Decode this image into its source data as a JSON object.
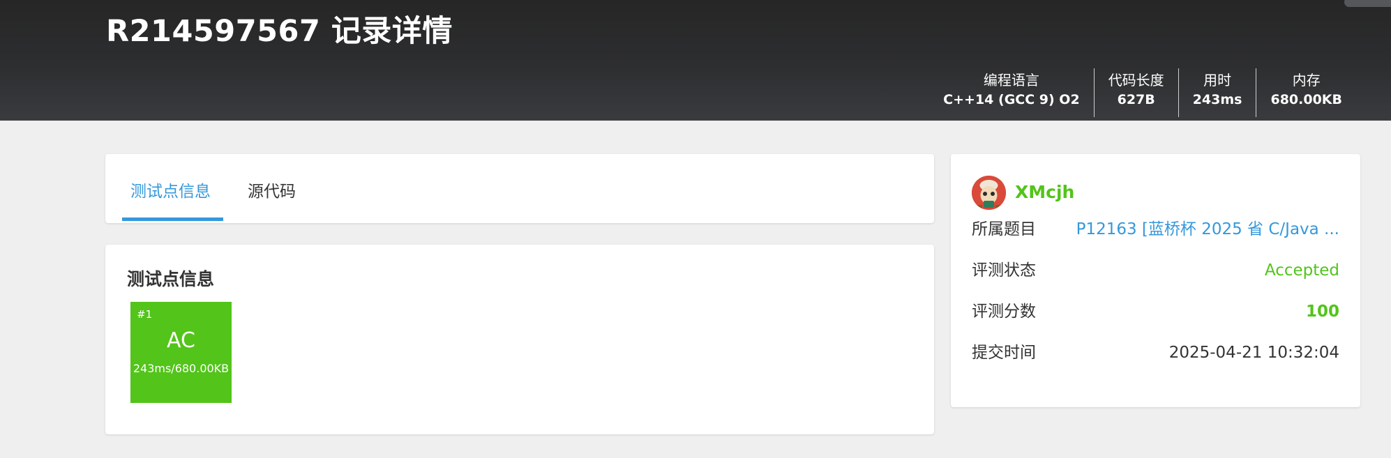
{
  "header": {
    "title": "R214597567 记录详情",
    "stats": [
      {
        "label": "编程语言",
        "value": "C++14 (GCC 9) O2"
      },
      {
        "label": "代码长度",
        "value": "627B"
      },
      {
        "label": "用时",
        "value": "243ms"
      },
      {
        "label": "内存",
        "value": "680.00KB"
      }
    ]
  },
  "tabs": [
    {
      "label": "测试点信息",
      "active": true
    },
    {
      "label": "源代码",
      "active": false
    }
  ],
  "testcases": {
    "section_title": "测试点信息",
    "items": [
      {
        "number": "#1",
        "status": "AC",
        "detail": "243ms/680.00KB",
        "color": "#52c41a"
      }
    ]
  },
  "sidebar": {
    "username": "XMcjh",
    "rows": [
      {
        "label": "所属题目",
        "value": "P12163 [蓝桥杯 2025 省 C/Java ..."
      },
      {
        "label": "评测状态",
        "value": "Accepted"
      },
      {
        "label": "评测分数",
        "value": "100"
      },
      {
        "label": "提交时间",
        "value": "2025-04-21 10:32:04"
      }
    ]
  },
  "colors": {
    "accent": "#3498db",
    "success": "#52c41a",
    "header_bg": "#2d2e30"
  }
}
